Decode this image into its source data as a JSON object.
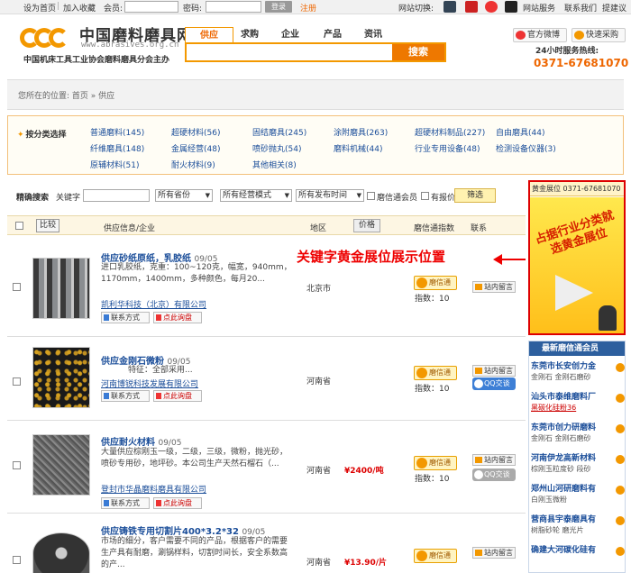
{
  "topbar": {
    "home": "设为首页",
    "fav": "加入收藏",
    "member": "会员:",
    "pwd": "密码:",
    "login": "登录",
    "register": "注册",
    "switch": "网站切换:",
    "service": "网站服务",
    "contact": "联系我们",
    "feedback": "提建议"
  },
  "header": {
    "logo_cn": "中国磨料磨具网",
    "logo_url": "www.abrasives.org.cn",
    "logo_sub": "中国机床工具工业协会磨料磨具分会主办",
    "tabs": [
      "供应",
      "求购",
      "企业",
      "产品",
      "资讯"
    ],
    "search_btn": "搜索",
    "weibo": "官方微博",
    "quick": "快速采购",
    "hotline": "24小时服务热线:",
    "phone": "0371-67681070"
  },
  "breadcrumb": "您所在的位置: 首页 » 供应",
  "categories": {
    "label": "按分类选择",
    "items": [
      "普通磨料(145)",
      "超硬材料(56)",
      "固结磨具(245)",
      "涂附磨具(263)",
      "超硬材料制品(227)",
      "自由磨具(44)",
      "纤维磨具(148)",
      "金属经营(48)",
      "喷砂抛丸(54)",
      "磨料机械(44)",
      "行业专用设备(48)",
      "检测设备仪器(3)",
      "原辅材料(51)",
      "耐火材料(9)",
      "其他相关(8)"
    ]
  },
  "filter": {
    "label": "精确搜索",
    "keyword": "关键字",
    "province": "所有省份",
    "mode": "所有经营模式",
    "time": "所有发布时间",
    "member": "磨信通会员",
    "price": "有报价",
    "btn": "筛选"
  },
  "table": {
    "compare": "比较",
    "info": "供应信息/企业",
    "region": "地区",
    "price": "价格",
    "index": "磨信通指数",
    "contact": "联系"
  },
  "products": [
    {
      "title": "供应砂纸原纸，乳胶纸",
      "date": "09/05",
      "desc": "进口乳胶纸，克重：100~120克，幅宽，940mm，1170mm，1400mm，多种颜色，每月20...",
      "company": "凯利华科技（北京）有限公司",
      "region": "北京市",
      "price": "",
      "index": "指数：10"
    },
    {
      "title": "供应金刚石微粉",
      "date": "09/05",
      "desc": "特征：全部采用...",
      "company": "河南博锐科技发展有限公司",
      "region": "河南省",
      "price": "",
      "index": "指数：10"
    },
    {
      "title": "供应耐火材料",
      "date": "09/05",
      "desc": "大量供应棕刚玉一级，二级，三级，微粉，抛光砂，喷砂专用砂，地坪砂。本公司生产天然石榴石（...",
      "company": "登封市华晶磨料磨具有限公司",
      "region": "河南省",
      "price": "¥2400/吨",
      "index": "指数：10"
    },
    {
      "title": "供应铸铁专用切割片400*3.2*32",
      "date": "09/05",
      "desc": "市场的细分，客户需要不同的产品，根据客户的需要生产具有耐磨，涮锅样料，切割时间长，安全系数高的产...",
      "company": "",
      "region": "河南省",
      "price": "¥13.90/片",
      "index": "指数：10"
    }
  ],
  "labels": {
    "contact_btn": "联系方式",
    "inquiry_btn": "点此询盘",
    "mxt": "磨信通",
    "msg": "站内留言",
    "qq": "QQ交谈"
  },
  "annotation": "关键字黄金展位展示位置",
  "gold": {
    "head": "黄金展位 0371-67681070",
    "text": "占据行业分类就选黄金展位"
  },
  "members": {
    "head": "最新磨信通会员",
    "items": [
      {
        "name": "东莞市长安创力金",
        "sub": "金刚石 金刚石磨砂",
        "tag": ""
      },
      {
        "name": "汕头市泰维磨料厂",
        "sub": "黑碳化硅粉36",
        "tag": "黑碳化硅粉36"
      },
      {
        "name": "东莞市创力研磨料",
        "sub": "金刚石 金刚石磨砂",
        "tag": ""
      },
      {
        "name": "河南伊龙高新材料",
        "sub": "棕刚玉粒度砂 段砂",
        "tag": ""
      },
      {
        "name": "郑州山河研磨料有",
        "sub": "白刚玉微粉",
        "tag": ""
      },
      {
        "name": "营商县宇泰磨具有",
        "sub": "树脂砂轮 磨光片",
        "tag": ""
      },
      {
        "name": "确建大河碳化硅有",
        "sub": "",
        "tag": ""
      }
    ]
  }
}
